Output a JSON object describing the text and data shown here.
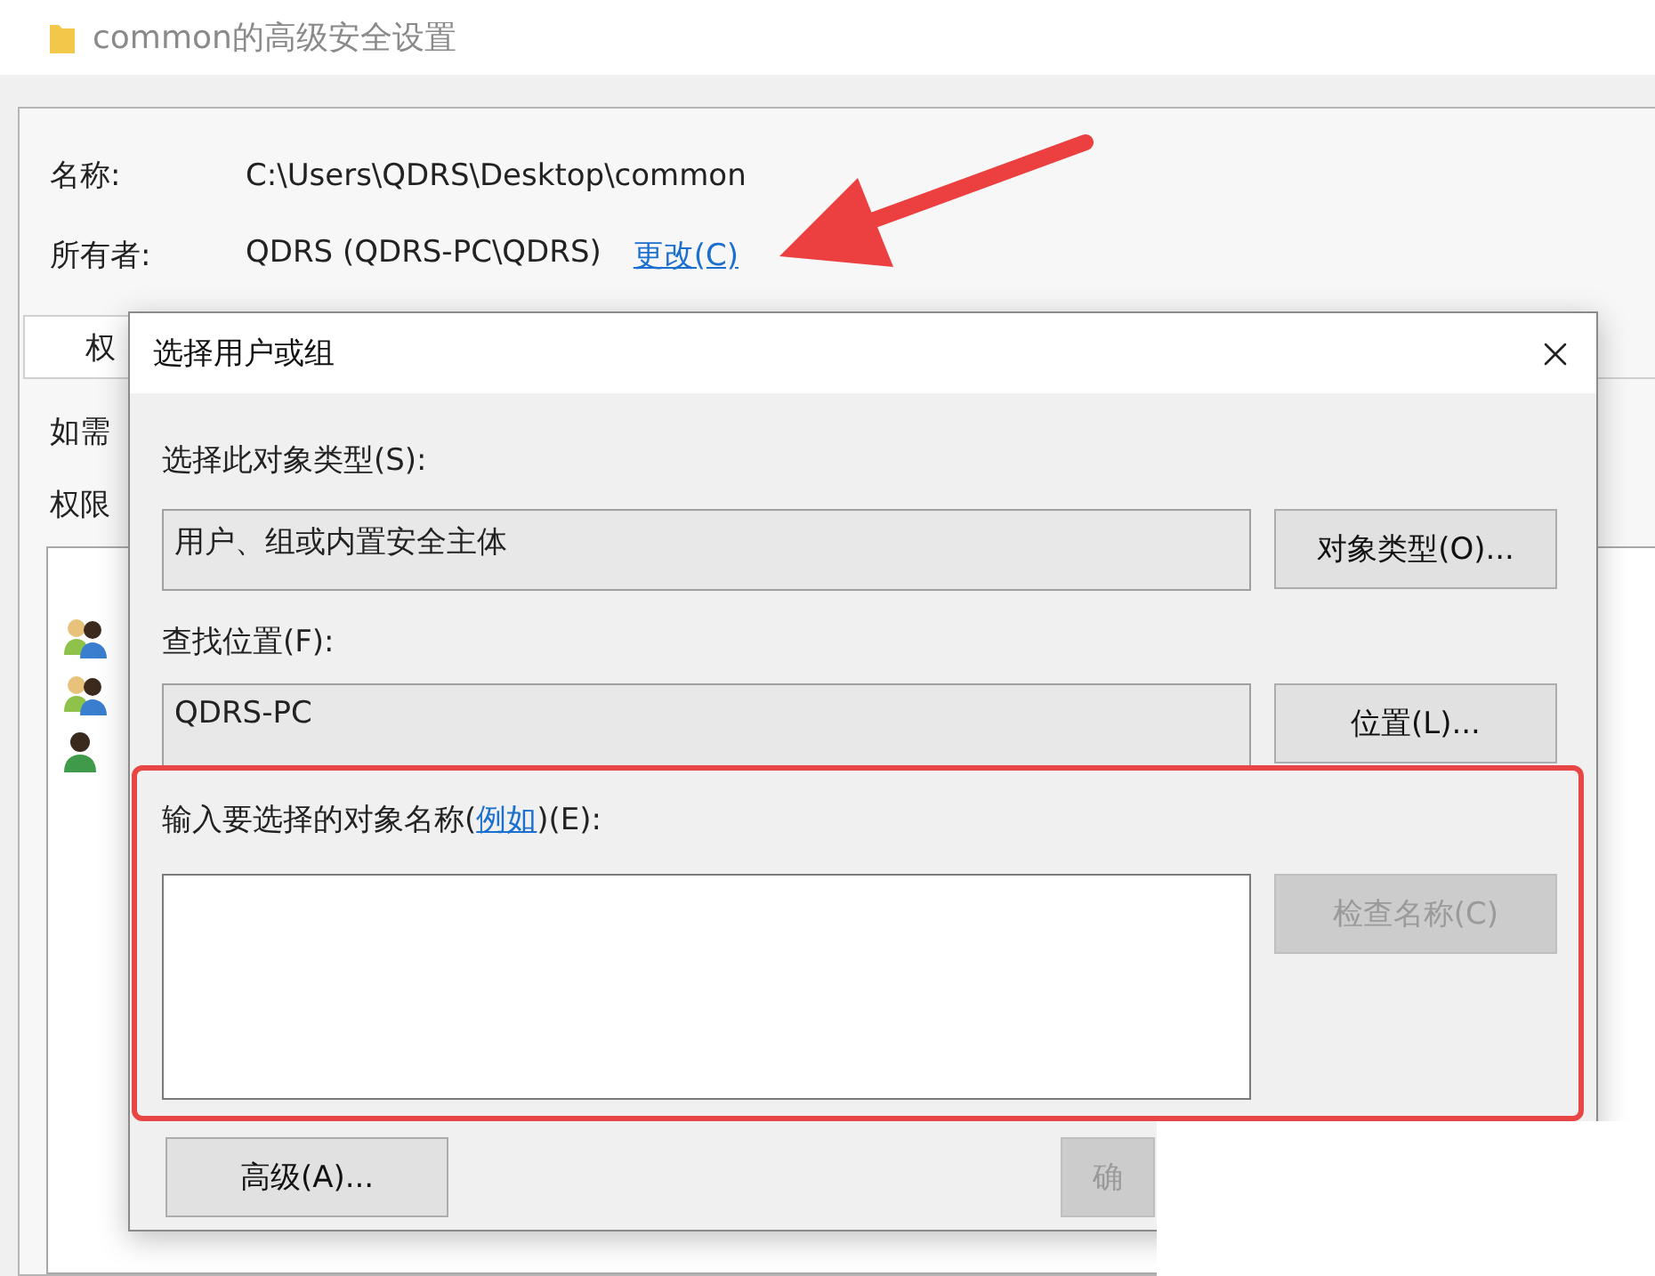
{
  "window": {
    "title": "common的高级安全设置"
  },
  "properties": [
    {
      "label": "名称:",
      "value": "C:\\Users\\QDRS\\Desktop\\common"
    },
    {
      "label": "所有者:",
      "value": "QDRS (QDRS-PC\\QDRS)",
      "link": "更改(C)"
    }
  ],
  "tabs": [
    {
      "label": "权",
      "selected": true
    }
  ],
  "cut_lines": [
    "如需",
    "权限"
  ],
  "principals": [
    {
      "kind": "group"
    },
    {
      "kind": "group"
    },
    {
      "kind": "user"
    }
  ],
  "dialog": {
    "title": "选择用户或组",
    "object_type": {
      "label": "选择此对象类型(S):",
      "value": "用户、组或内置安全主体",
      "button": "对象类型(O)..."
    },
    "location": {
      "label": "查找位置(F):",
      "value": "QDRS-PC",
      "button": "位置(L)..."
    },
    "names": {
      "label_start": "输入要选择的对象名称(",
      "link": "例如",
      "label_end": ")(E):",
      "button": "检查名称(C)",
      "button_disabled": true
    },
    "buttons": [
      {
        "label": "高级(A)...",
        "disabled": false
      },
      {
        "label": "确",
        "disabled": true
      }
    ]
  }
}
